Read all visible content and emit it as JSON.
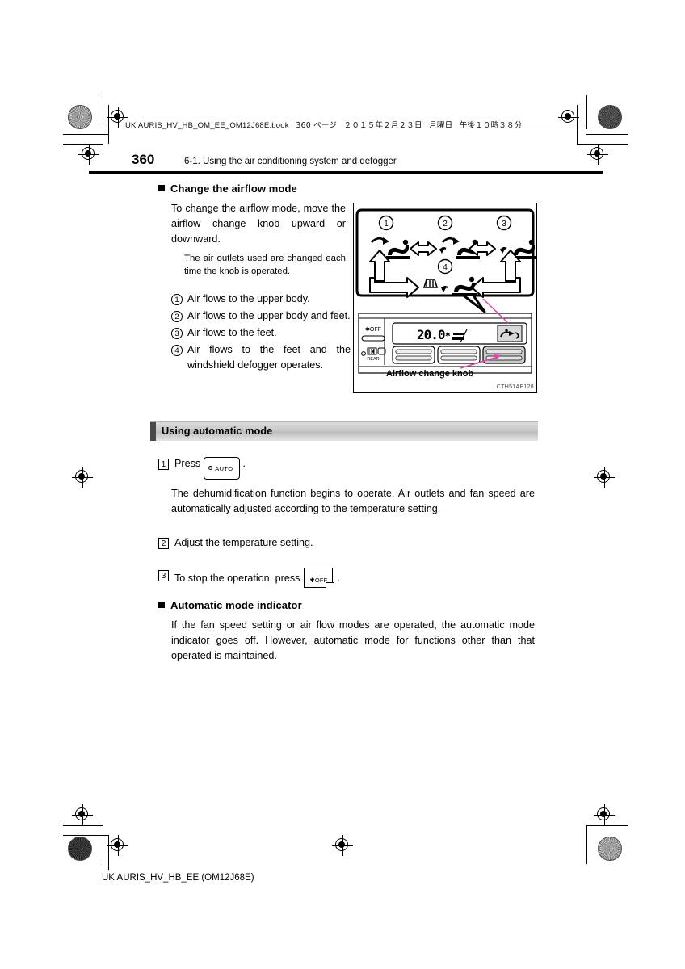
{
  "print_header": {
    "filename": "UK AURIS_HV_HB_OM_EE_OM12J68E.book",
    "page_marker": "360 ページ",
    "date": "２０１５年２月２３日",
    "weekday": "月曜日",
    "time": "午後１０時３８分"
  },
  "page": {
    "folio": "360",
    "chapter_title": "6-1. Using the air conditioning system and defogger",
    "footer": "UK AURIS_HV_HB_EE (OM12J68E)"
  },
  "airflow_section": {
    "heading": "Change the airflow mode",
    "intro": "To change the airflow mode, move the airflow change knob upward or downward.",
    "note": "The air outlets used are changed each time the knob is operated.",
    "items": [
      {
        "num": "1",
        "text": "Air flows to the upper body."
      },
      {
        "num": "2",
        "text": "Air flows to the upper body and feet."
      },
      {
        "num": "3",
        "text": "Air flows to the feet."
      },
      {
        "num": "4",
        "text": "Air flows to the feet and the windshield defogger operates."
      }
    ]
  },
  "figure": {
    "callout_labels": [
      "1",
      "2",
      "3",
      "4"
    ],
    "knob_label": "Airflow change knob",
    "figure_code": "CTH51AP128",
    "display_temperature": "20.0",
    "off_button_label": "OFF",
    "rear_button_label": "REAR",
    "pointer_color": "#e53fa8"
  },
  "auto_section": {
    "bar_title": "Using automatic mode",
    "steps": [
      {
        "num": "1",
        "before": "Press",
        "button": "auto-button",
        "after": "."
      },
      {
        "num": "2",
        "before": "Adjust the temperature setting.",
        "button": "",
        "after": ""
      },
      {
        "num": "3",
        "before": "To stop the operation, press",
        "button": "off-button",
        "after": "."
      }
    ],
    "step1_note": "The dehumidification function begins to operate. Air outlets and fan speed are automatically adjusted according to the temperature setting.",
    "auto_button_label": "AUTO",
    "off_button_label": "OFF"
  },
  "indicator_section": {
    "heading": "Automatic mode indicator",
    "body": "If the fan speed setting or air flow modes are operated, the automatic mode indicator goes off. However, automatic mode for functions other than that operated is maintained."
  }
}
